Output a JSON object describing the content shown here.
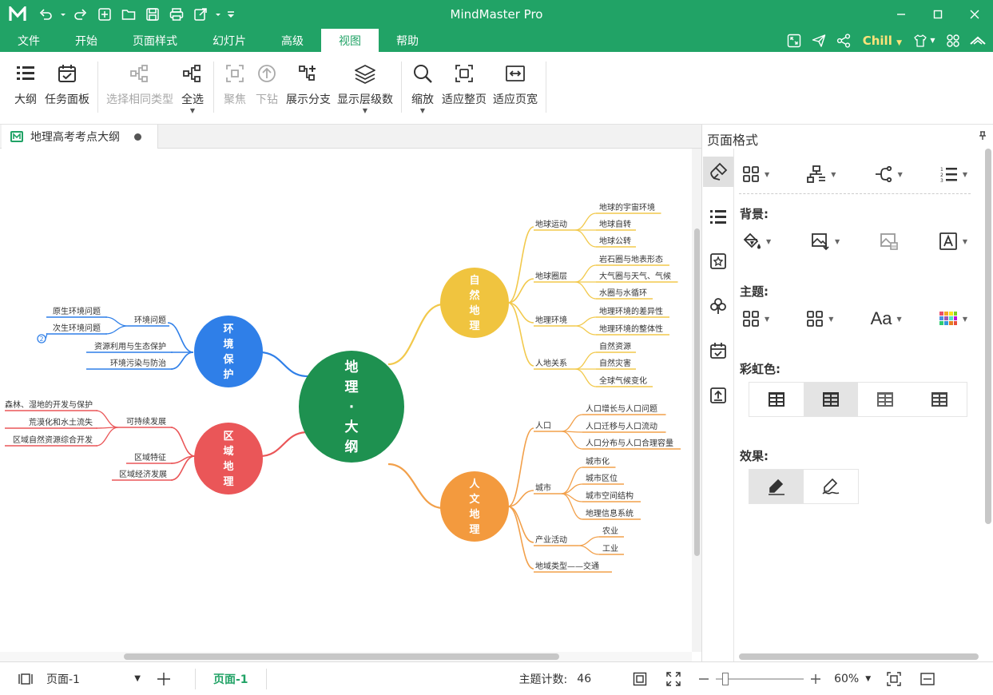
{
  "app": {
    "title": "MindMaster Pro"
  },
  "menu": {
    "tabs": [
      "文件",
      "开始",
      "页面样式",
      "幻灯片",
      "高级",
      "视图",
      "帮助"
    ],
    "active_tab": "视图",
    "theme_label": "Chill"
  },
  "ribbon": {
    "outline": "大纲",
    "task_panel": "任务面板",
    "select_same_type": "选择相同类型",
    "select_all": "全选",
    "focus": "聚焦",
    "drill_down": "下钻",
    "show_branch": "展示分支",
    "show_levels": "显示层级数",
    "zoom": "缩放",
    "fit_page": "适应整页",
    "fit_width": "适应页宽"
  },
  "document": {
    "tab_name": "地理高考考点大纲"
  },
  "mindmap": {
    "central": [
      "地",
      "理",
      "·",
      "大",
      "纲"
    ],
    "main_topics": {
      "natural": [
        "自",
        "然",
        "地",
        "理"
      ],
      "human": [
        "人",
        "文",
        "地",
        "理"
      ],
      "environment": [
        "环",
        "境",
        "保",
        "护"
      ],
      "regional": [
        "区",
        "域",
        "地",
        "理"
      ]
    },
    "natural_branches": [
      {
        "label": "地球运动",
        "children": [
          "地球的宇宙环境",
          "地球自转",
          "地球公转"
        ]
      },
      {
        "label": "地球圈层",
        "children": [
          "岩石圈与地表形态",
          "大气圈与天气、气候",
          "水圈与水循环"
        ]
      },
      {
        "label": "地理环境",
        "children": [
          "地理环境的差异性",
          "地理环境的整体性"
        ]
      },
      {
        "label": "人地关系",
        "children": [
          "自然资源",
          "自然灾害",
          "全球气候变化"
        ]
      }
    ],
    "human_branches": [
      {
        "label": "人口",
        "children": [
          "人口增长与人口问题",
          "人口迁移与人口流动",
          "人口分布与人口合理容量"
        ]
      },
      {
        "label": "城市",
        "children": [
          "城市化",
          "城市区位",
          "城市空间结构",
          "地理信息系统"
        ]
      },
      {
        "label": "产业活动",
        "children": [
          "农业",
          "工业"
        ]
      },
      {
        "label": "地域类型——交通",
        "children": []
      }
    ],
    "environment_branches": [
      {
        "label": "环境问题",
        "children": [
          "原生环境问题",
          "次生环境问题"
        ]
      },
      {
        "label": "资源利用与生态保护",
        "children": []
      },
      {
        "label": "环境污染与防治",
        "children": []
      }
    ],
    "environment_collapsed_count": "2",
    "regional_branches": [
      {
        "label": "可持续发展",
        "children": [
          "森林、湿地的开发与保护",
          "荒漠化和水土流失",
          "区域自然资源综合开发"
        ]
      },
      {
        "label": "区域特征",
        "children": []
      },
      {
        "label": "区域经济发展",
        "children": []
      }
    ],
    "colors": {
      "central": "#1e9150",
      "natural": "#f0c43f",
      "human": "#f39a3e",
      "environment": "#2f7fe8",
      "regional": "#ea5658",
      "natural_line": "#f2c94c",
      "human_line": "#f2a04a"
    }
  },
  "panel": {
    "title": "页面格式",
    "background_label": "背景:",
    "theme_label": "主题:",
    "rainbow_label": "彩虹色:",
    "effects_label": "效果:"
  },
  "status": {
    "page_select": "页面-1",
    "page_tab": "页面-1",
    "topic_count_label": "主题计数:",
    "topic_count": "46",
    "zoom": "60%"
  }
}
